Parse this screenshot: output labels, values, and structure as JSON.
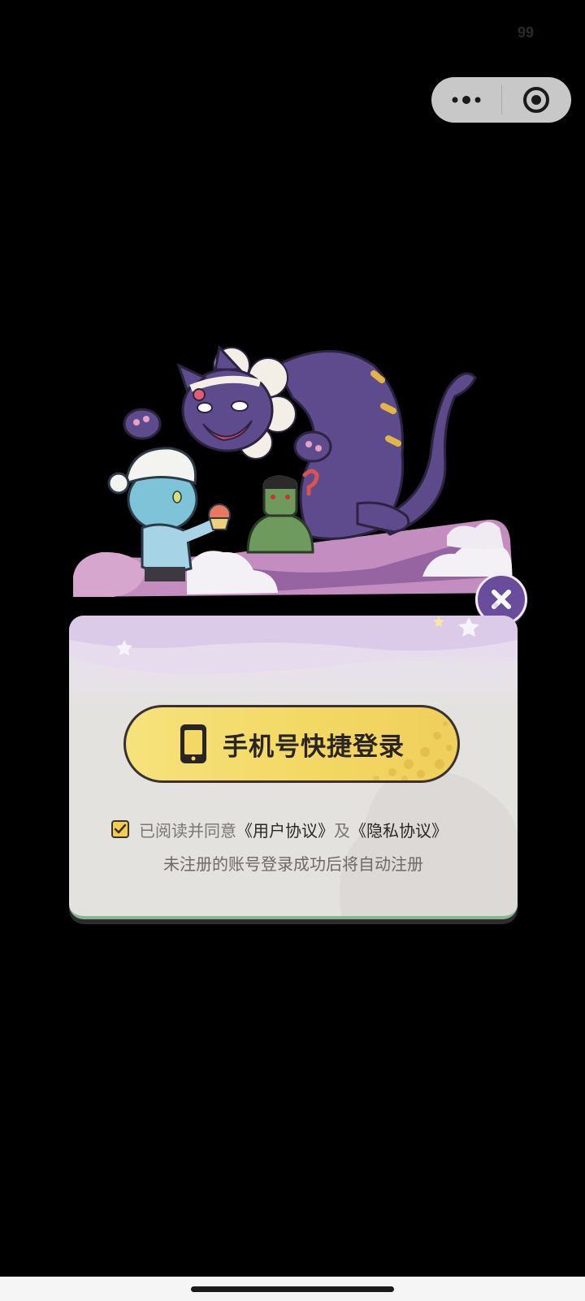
{
  "status_bar": {
    "number": "99"
  },
  "capsule": {
    "more_icon": "more-dots-icon",
    "close_icon": "target-circle-icon"
  },
  "login_card": {
    "login_button_label": "手机号快捷登录",
    "login_button_icon": "smartphone-icon",
    "agreement": {
      "checked": true,
      "prefix": "已阅读并同意",
      "user_agreement": "《用户协议》",
      "conjunction": "及",
      "privacy_agreement": "《隐私协议》"
    },
    "note": "未注册的账号登录成功后将自动注册"
  },
  "close_button": {
    "icon": "close-x-icon"
  },
  "colors": {
    "background": "#000000",
    "button_yellow": "#f3d864",
    "close_purple": "#6a4c9c",
    "card_bg": "#e4e2df"
  }
}
